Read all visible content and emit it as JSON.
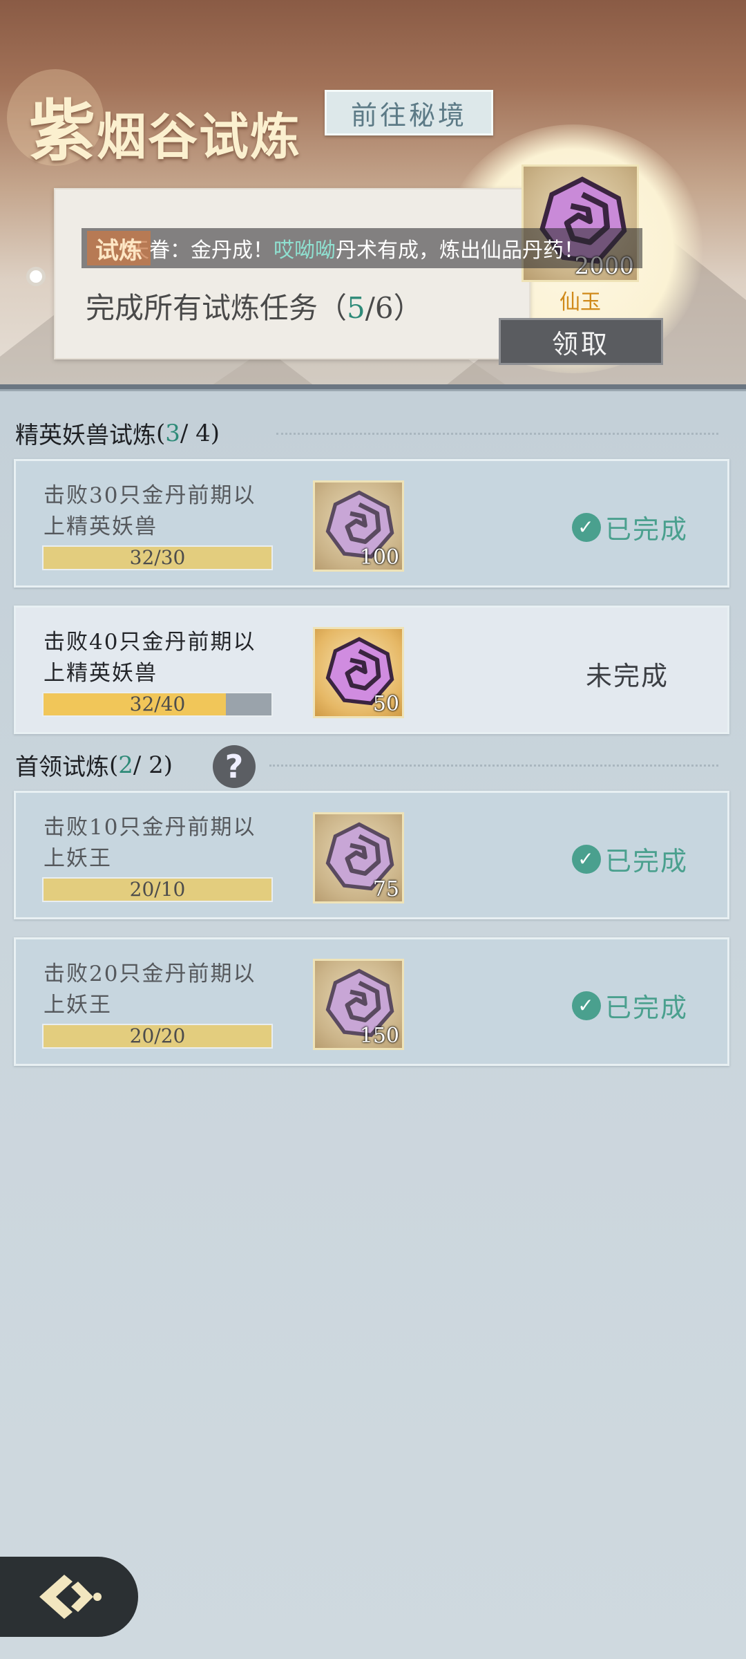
{
  "header": {
    "title_big": "紫",
    "title_rest": "烟谷试炼",
    "goto_button": "前往秘境",
    "ticker_badge": "试炼",
    "ticker_prefix": "天眷：金丹成！",
    "ticker_name": "哎呦呦",
    "ticker_suffix": "丹术有成，炼出仙品丹药！",
    "overall_task": "完成所有试炼任务（",
    "overall_done": "5",
    "overall_total": "/6）",
    "main_reward": {
      "qty": "2000",
      "label": "仙玉",
      "icon": "jade-icon"
    },
    "claim_button": "领取"
  },
  "sections": [
    {
      "title": "精英妖兽试炼",
      "open": " (",
      "done": "3",
      "total": " / 4)"
    },
    {
      "title": "首领试炼",
      "open": " (",
      "done": "2",
      "total": " / 2)",
      "help": "?"
    }
  ],
  "tasks": [
    {
      "text": "击败30只金丹前期以上精英妖兽",
      "progress": "32/30",
      "fill": 1.0,
      "reward_qty": "100",
      "status": "已完成",
      "done": true
    },
    {
      "text": "击败40只金丹前期以上精英妖兽",
      "progress": "32/40",
      "fill": 0.8,
      "reward_qty": "50",
      "status": "未完成",
      "done": false
    },
    {
      "text": "击败10只金丹前期以上妖王",
      "progress": "20/10",
      "fill": 1.0,
      "reward_qty": "75",
      "status": "已完成",
      "done": true
    },
    {
      "text": "击败20只金丹前期以上妖王",
      "progress": "20/20",
      "fill": 1.0,
      "reward_qty": "150",
      "status": "已完成",
      "done": true
    }
  ],
  "colors": {
    "accent": "#2e8a78",
    "done": "#4aa08e",
    "reward_label": "#d08a1a"
  },
  "icons": {
    "reward": "jade-icon",
    "check": "check-icon",
    "help": "question-icon",
    "back": "back-arrow-icon"
  }
}
